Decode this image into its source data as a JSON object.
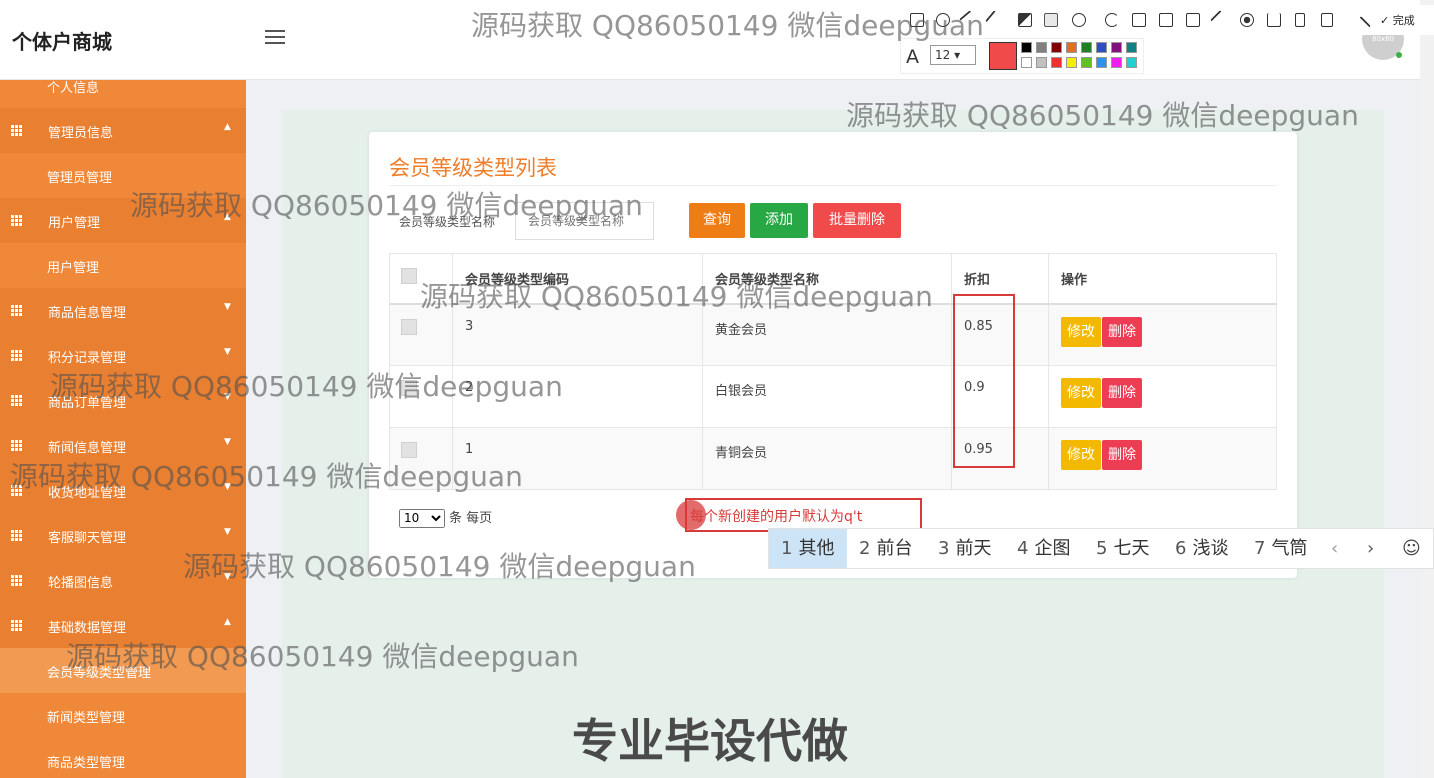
{
  "header": {
    "app_title": "个体户商城",
    "avatar_text": "80x80"
  },
  "sidebar": {
    "items": [
      {
        "label": "个人信息",
        "kind": "sub"
      },
      {
        "label": "管理员信息",
        "kind": "group",
        "caret": "▲"
      },
      {
        "label": "管理员管理",
        "kind": "sub"
      },
      {
        "label": "用户管理",
        "kind": "group",
        "caret": "▲"
      },
      {
        "label": "用户管理",
        "kind": "sub"
      },
      {
        "label": "商品信息管理",
        "kind": "group",
        "caret": "▼"
      },
      {
        "label": "积分记录管理",
        "kind": "group",
        "caret": "▼"
      },
      {
        "label": "商品订单管理",
        "kind": "group",
        "caret": "▼"
      },
      {
        "label": "新闻信息管理",
        "kind": "group",
        "caret": "▼"
      },
      {
        "label": "收货地址管理",
        "kind": "group",
        "caret": "▼"
      },
      {
        "label": "客服聊天管理",
        "kind": "group",
        "caret": "▼"
      },
      {
        "label": "轮播图信息",
        "kind": "group",
        "caret": "▼"
      },
      {
        "label": "基础数据管理",
        "kind": "group",
        "caret": "▲"
      },
      {
        "label": "会员等级类型管理",
        "kind": "sub",
        "active": true
      },
      {
        "label": "新闻类型管理",
        "kind": "sub"
      },
      {
        "label": "商品类型管理",
        "kind": "sub"
      }
    ]
  },
  "panel": {
    "title": "会员等级类型列表",
    "search_label": "会员等级类型名称",
    "search_placeholder": "会员等级类型名称",
    "query_button": "查询",
    "add_button": "添加",
    "batch_delete_button": "批量删除"
  },
  "table": {
    "headers": [
      "会员等级类型编码",
      "会员等级类型名称",
      "折扣",
      "操作"
    ],
    "rows": [
      {
        "code": "3",
        "name": "黄金会员",
        "discount": "0.85"
      },
      {
        "code": "2",
        "name": "白银会员",
        "discount": "0.9"
      },
      {
        "code": "1",
        "name": "青铜会员",
        "discount": "0.95"
      }
    ],
    "edit_label": "修改",
    "delete_label": "删除"
  },
  "pager": {
    "page_size": "10",
    "suffix": "条 每页"
  },
  "annotation": {
    "text": "每个新创建的用户默认为q't"
  },
  "ime": {
    "candidates": [
      {
        "num": "1",
        "text": "其他"
      },
      {
        "num": "2",
        "text": "前台"
      },
      {
        "num": "3",
        "text": "前天"
      },
      {
        "num": "4",
        "text": "企图"
      },
      {
        "num": "5",
        "text": "七天"
      },
      {
        "num": "6",
        "text": "浅谈"
      },
      {
        "num": "7",
        "text": "气筒"
      }
    ],
    "prev": "‹",
    "next": "›",
    "emoji": "☺"
  },
  "screenshot_tool": {
    "done_label": "完成",
    "font_size": "12",
    "current_color": "#f04a4a",
    "palette": [
      "#000000",
      "#808080",
      "#800000",
      "#e07020",
      "#208020",
      "#3050c0",
      "#801080",
      "#108080",
      "#ffffff",
      "#c0c0c0",
      "#f03030",
      "#f0f000",
      "#60c020",
      "#3090f0",
      "#f020f0",
      "#20d0d0"
    ]
  },
  "watermarks": {
    "text": "源码获取 QQ86050149 微信deepguan",
    "bottom": "专业毕设代做"
  }
}
